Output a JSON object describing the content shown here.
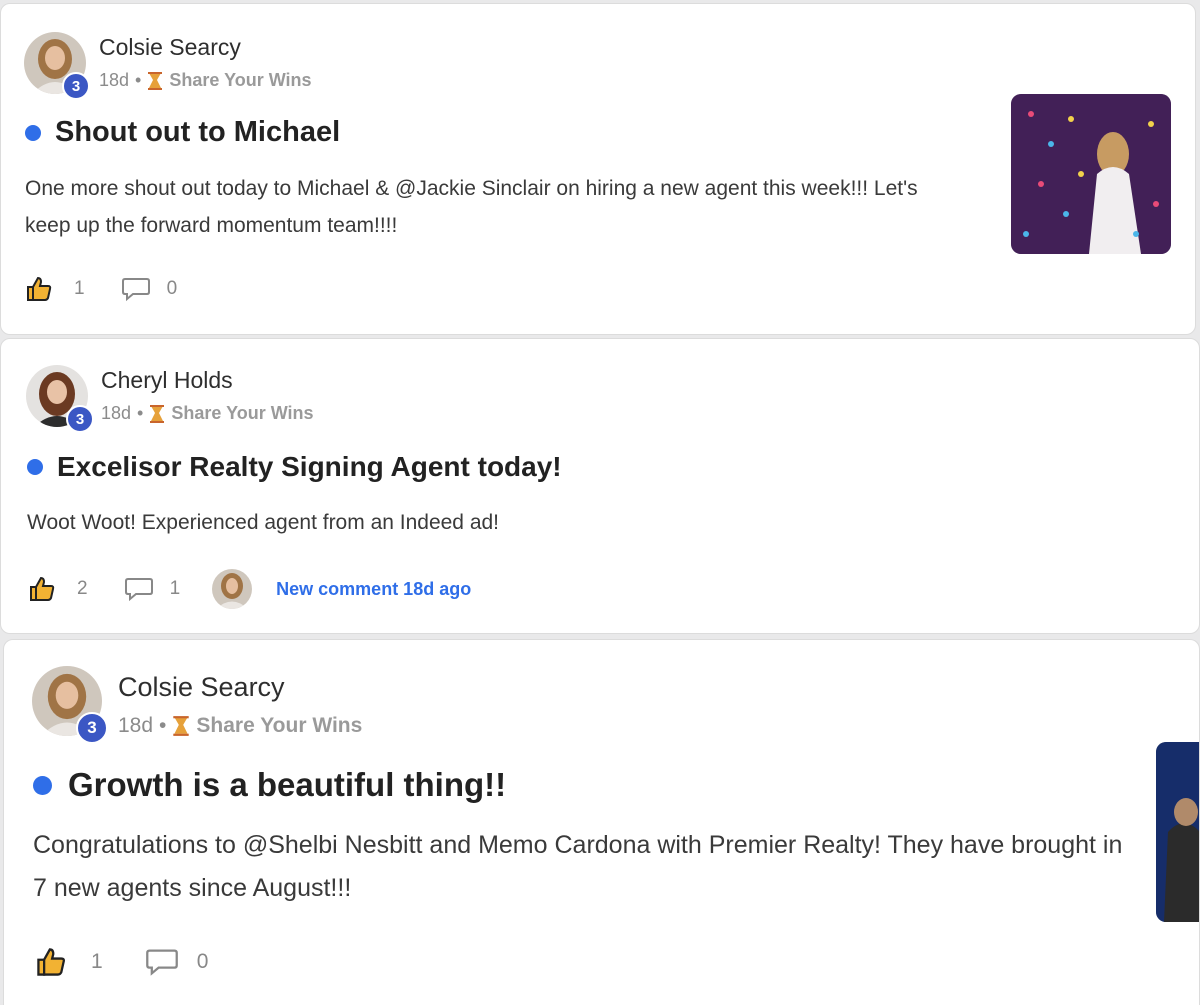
{
  "posts": [
    {
      "author": "Colsie Searcy",
      "level": "3",
      "time": "18d",
      "separator": "•",
      "category": "Share Your Wins",
      "title": "Shout out to Michael",
      "body": "One more shout out today to Michael & @Jackie Sinclair on hiring a new agent this week!!! Let's keep up the forward momentum team!!!!",
      "likes": "1",
      "comments": "0",
      "icons": {
        "like": "thumbs-up-icon",
        "comment": "comment-bubble-icon",
        "category": "trophy-icon"
      }
    },
    {
      "author": "Cheryl Holds",
      "level": "3",
      "time": "18d",
      "separator": "•",
      "category": "Share Your Wins",
      "title": "Excelisor Realty Signing Agent today!",
      "body": "Woot Woot! Experienced agent from an Indeed ad!",
      "likes": "2",
      "comments": "1",
      "new_comment": "New comment 18d ago",
      "icons": {
        "like": "thumbs-up-icon",
        "comment": "comment-bubble-icon",
        "category": "trophy-icon"
      }
    },
    {
      "author": "Colsie Searcy",
      "level": "3",
      "time": "18d",
      "separator": "•",
      "category": "Share Your Wins",
      "title": "Growth is a beautiful thing!!",
      "body": "Congratulations to @Shelbi Nesbitt and Memo Cardona with Premier Realty! They have brought in 7 new agents since August!!!",
      "likes": "1",
      "comments": "0",
      "icons": {
        "like": "thumbs-up-icon",
        "comment": "comment-bubble-icon",
        "category": "trophy-icon"
      }
    }
  ],
  "colors": {
    "accent": "#2f6ee8",
    "badge": "#3b57c4",
    "unread": "#2f6ee8"
  }
}
